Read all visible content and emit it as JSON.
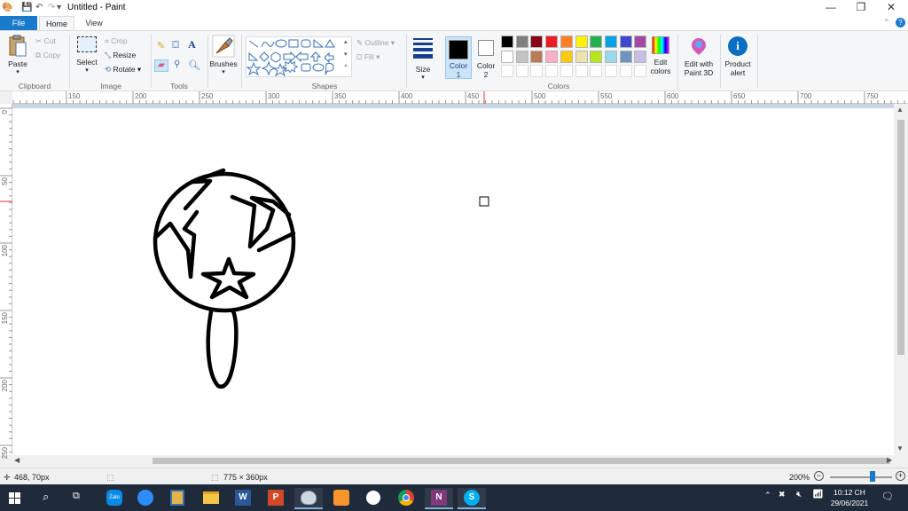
{
  "window": {
    "title": "Untitled - Paint",
    "controls": {
      "minimize": "—",
      "restore": "❐",
      "close": "✕"
    }
  },
  "tabs": [
    "File",
    "Home",
    "View"
  ],
  "ribbon": {
    "clipboard": {
      "paste": "Paste",
      "cut": "Cut",
      "copy": "Copy",
      "label": "Clipboard"
    },
    "image": {
      "select": "Select",
      "crop": "Crop",
      "resize": "Resize",
      "rotate": "Rotate",
      "label": "Image"
    },
    "tools": {
      "label": "Tools"
    },
    "brushes": {
      "label": "Brushes"
    },
    "shapes": {
      "outline": "Outline",
      "fill": "Fill",
      "label": "Shapes"
    },
    "size": {
      "label": "Size"
    },
    "color1": {
      "line1": "Color",
      "line2": "1"
    },
    "color2": {
      "line1": "Color",
      "line2": "2"
    },
    "colors": {
      "label": "Colors"
    },
    "edit_colors": {
      "line1": "Edit",
      "line2": "colors"
    },
    "paint3d": {
      "line1": "Edit with",
      "line2": "Paint 3D"
    },
    "product_alert": {
      "line1": "Product",
      "line2": "alert"
    },
    "palette_row1": [
      "#000000",
      "#7f7f7f",
      "#880015",
      "#ed1c24",
      "#ff7f27",
      "#fff200",
      "#22b14c",
      "#00a2e8",
      "#3f48cc",
      "#a349a4"
    ],
    "palette_row2": [
      "#ffffff",
      "#c3c3c3",
      "#b97a57",
      "#ffaec9",
      "#ffc90e",
      "#efe4b0",
      "#b5e61d",
      "#99d9ea",
      "#7092be",
      "#c8bfe7"
    ],
    "palette_row3_empty": 10,
    "color1_value": "#000000",
    "color2_value": "#ffffff"
  },
  "ruler": {
    "horizontal": [
      "150",
      "200",
      "250",
      "300",
      "350",
      "400",
      "450",
      "500",
      "550",
      "600",
      "650",
      "700",
      "750"
    ],
    "vertical": [
      "0",
      "50",
      "100",
      "150",
      "200",
      "250"
    ]
  },
  "status": {
    "cursor_pos": "468, 70px",
    "image_size": "775 × 360px",
    "zoom": "200%",
    "zoom_fraction": 0.68
  },
  "taskbar": {
    "time": "10:12 CH",
    "date": "29/06/2021",
    "apps": [
      "windows-start",
      "search",
      "task-view",
      "zalo",
      "zoom",
      "snipping",
      "file-explorer",
      "word",
      "powerpoint",
      "paint",
      "sublime",
      "media",
      "chrome",
      "onenote",
      "skype"
    ]
  }
}
